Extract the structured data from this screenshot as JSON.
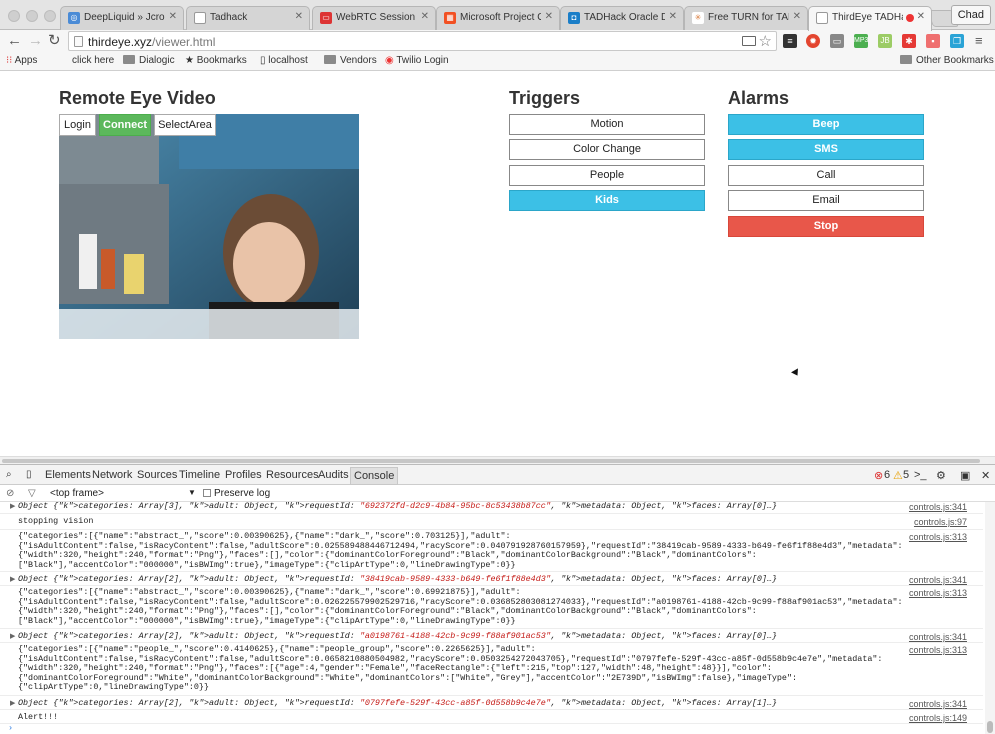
{
  "browser": {
    "tabs": [
      {
        "title": "DeepLiquid » Jcrop I",
        "fav_color": "#4a8bd6",
        "fav_glyph": "◎"
      },
      {
        "title": "Tadhack",
        "fav_color": "#9a9a9a",
        "fav_glyph": ""
      },
      {
        "title": "WebRTC Session Co",
        "fav_color": "#d33",
        "fav_glyph": "▭"
      },
      {
        "title": "Microsoft Project Ox",
        "fav_color": "#f25022",
        "fav_glyph": "▦"
      },
      {
        "title": "TADHack Oracle Dev",
        "fav_color": "#1a7ec8",
        "fav_glyph": "◘"
      },
      {
        "title": "Free TURN for TADHa",
        "fav_color": "#e8a070",
        "fav_glyph": "✳"
      },
      {
        "title": "ThirdEye TADHack",
        "fav_color": "#ffffff",
        "fav_glyph": ""
      }
    ],
    "profile": "Chad",
    "url_host": "thirdeye.xyz",
    "url_path": "/viewer.html"
  },
  "bookmarks": {
    "apps": "Apps",
    "items": [
      "click here",
      "Dialogic",
      "Bookmarks",
      "localhost",
      "Vendors",
      "Twilio Login"
    ],
    "other": "Other Bookmarks"
  },
  "page": {
    "video_title": "Remote Eye Video",
    "video_buttons": [
      "Login",
      "Connect",
      "SelectArea"
    ],
    "triggers_title": "Triggers",
    "triggers": [
      "Motion",
      "Color Change",
      "People",
      "Kids"
    ],
    "alarms_title": "Alarms",
    "alarms": [
      "Beep",
      "SMS",
      "Call",
      "Email",
      "Stop"
    ],
    "colors": {
      "active": "#3cc0e6",
      "stop": "#e8574a",
      "connect": "#5cb85c"
    }
  },
  "devtools": {
    "tabs": [
      "Elements",
      "Network",
      "Sources",
      "Timeline",
      "Profiles",
      "Resources",
      "Audits",
      "Console"
    ],
    "errors": "6",
    "warnings": "5",
    "frame": "<top frame>",
    "preserve_log": "Preserve log",
    "logs": [
      {
        "text": "Object {categories: Array[3], adult: Object, requestId: \"692372fd-d2c9-4b84-95bc-8c53438b87cc\", metadata: Object, faces: Array[0]…}",
        "src": "controls.js:341"
      },
      {
        "text": "stopping vision",
        "src": "controls.js:97"
      },
      {
        "text": "{\"categories\":[{\"name\":\"abstract_\",\"score\":0.00390625},{\"name\":\"dark_\",\"score\":0.703125}],\"adult\":\n{\"isAdultContent\":false,\"isRacyContent\":false,\"adultScore\":0.025589488446712494,\"racyScore\":0.040791928760157959},\"requestId\":\"38419cab-9589-4333-b649-fe6f1f88e4d3\",\"metadata\":\n{\"width\":320,\"height\":240,\"format\":\"Png\"},\"faces\":[],\"color\":{\"dominantColorForeground\":\"Black\",\"dominantColorBackground\":\"Black\",\"dominantColors\":\n[\"Black\"],\"accentColor\":\"000000\",\"isBWImg\":true},\"imageType\":{\"clipArtType\":0,\"lineDrawingType\":0}}",
        "src": "controls.js:313"
      },
      {
        "text": "Object {categories: Array[2], adult: Object, requestId: \"38419cab-9589-4333-b649-fe6f1f88e4d3\", metadata: Object, faces: Array[0]…}",
        "src": "controls.js:341"
      },
      {
        "text": "{\"categories\":[{\"name\":\"abstract_\",\"score\":0.00390625},{\"name\":\"dark_\",\"score\":0.69921875}],\"adult\":\n{\"isAdultContent\":false,\"isRacyContent\":false,\"adultScore\":0.026225579902529716,\"racyScore\":0.036852803081274033},\"requestId\":\"a0198761-4188-42cb-9c99-f88af901ac53\",\"metadata\":\n{\"width\":320,\"height\":240,\"format\":\"Png\"},\"faces\":[],\"color\":{\"dominantColorForeground\":\"Black\",\"dominantColorBackground\":\"Black\",\"dominantColors\":\n[\"Black\"],\"accentColor\":\"000000\",\"isBWImg\":true},\"imageType\":{\"clipArtType\":0,\"lineDrawingType\":0}}",
        "src": "controls.js:313"
      },
      {
        "text": "Object {categories: Array[2], adult: Object, requestId: \"a0198761-4188-42cb-9c99-f88af901ac53\", metadata: Object, faces: Array[0]…}",
        "src": "controls.js:341"
      },
      {
        "text": "{\"categories\":[{\"name\":\"people_\",\"score\":0.4140625},{\"name\":\"people_group\",\"score\":0.2265625}],\"adult\":\n{\"isAdultContent\":false,\"isRacyContent\":false,\"adultScore\":0.0658210880504982,\"racyScore\":0.0503254272043705},\"requestId\":\"0797fefe-529f-43cc-a85f-0d558b9c4e7e\",\"metadata\":\n{\"width\":320,\"height\":240,\"format\":\"Png\"},\"faces\":[{\"age\":4,\"gender\":\"Female\",\"faceRectangle\":{\"left\":215,\"top\":127,\"width\":48,\"height\":48}}],\"color\":\n{\"dominantColorForeground\":\"White\",\"dominantColorBackground\":\"White\",\"dominantColors\":[\"White\",\"Grey\"],\"accentColor\":\"2E739D\",\"isBWImg\":false},\"imageType\":\n{\"clipArtType\":0,\"lineDrawingType\":0}}",
        "src": "controls.js:313"
      },
      {
        "text": "Object {categories: Array[2], adult: Object, requestId: \"0797fefe-529f-43cc-a85f-0d558b9c4e7e\", metadata: Object, faces: Array[1]…}",
        "src": "controls.js:341"
      },
      {
        "text": "Alert!!!",
        "src": "controls.js:149"
      }
    ]
  }
}
